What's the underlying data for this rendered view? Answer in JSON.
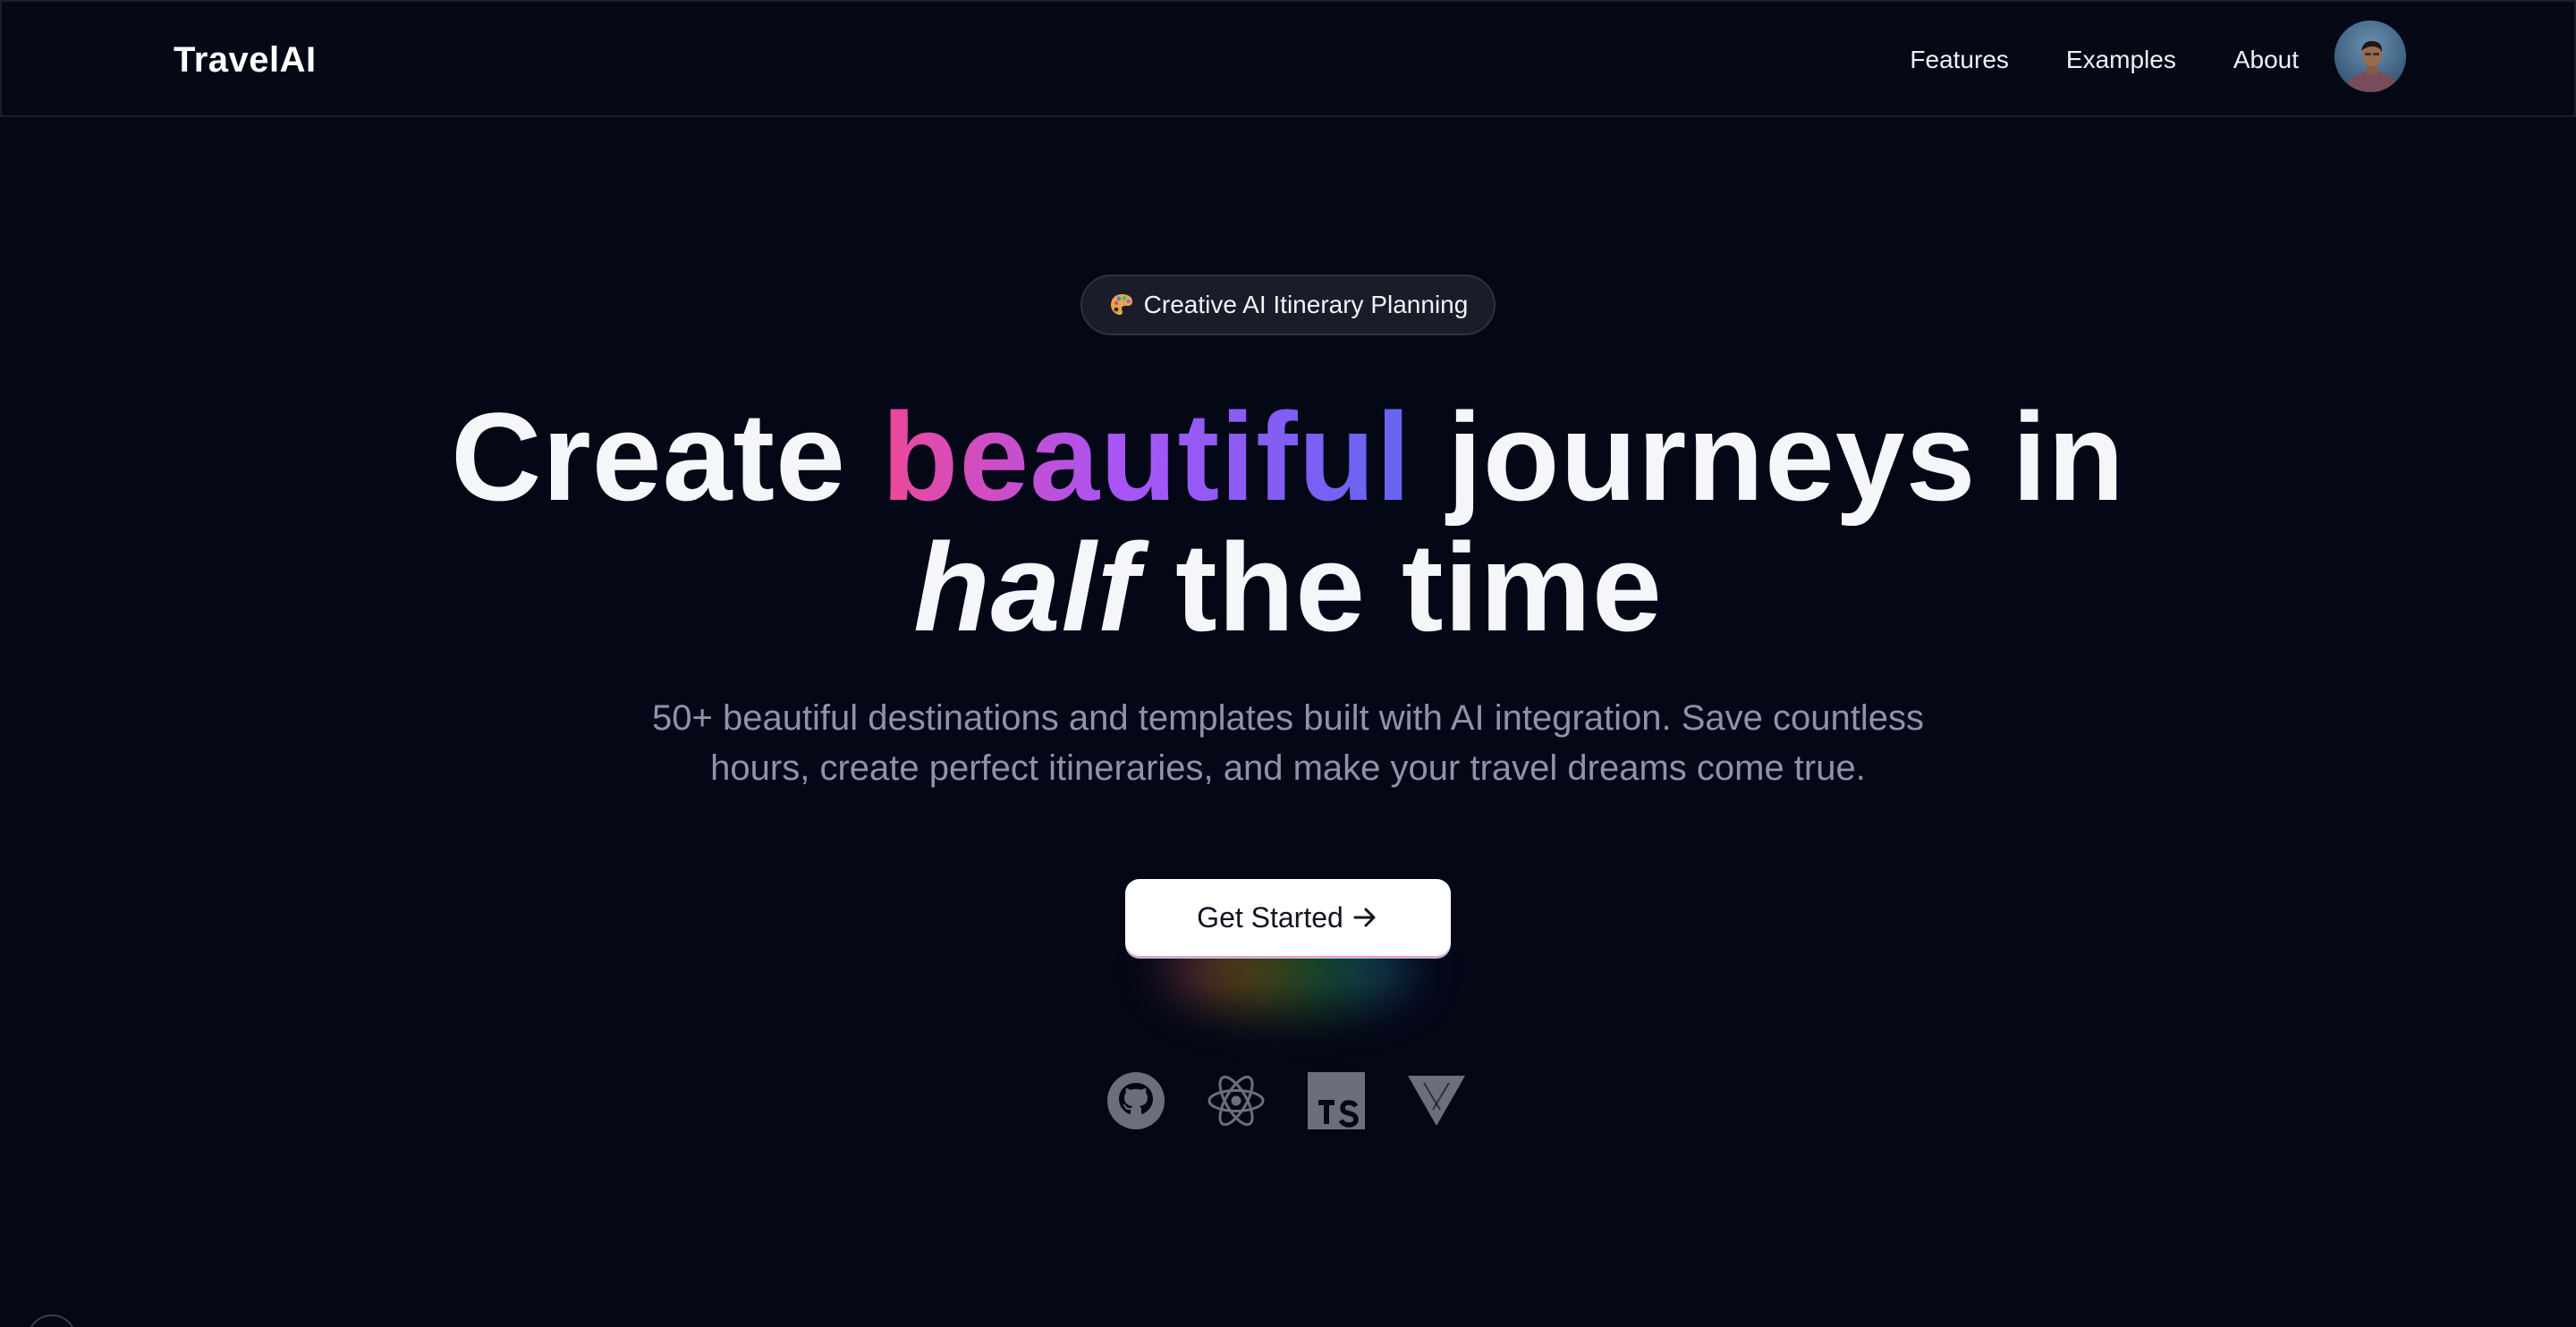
{
  "header": {
    "brand": "TravelAI",
    "nav": [
      {
        "label": "Features"
      },
      {
        "label": "Examples"
      },
      {
        "label": "About"
      }
    ],
    "avatar_icon": "user-avatar"
  },
  "hero": {
    "badge": {
      "icon": "palette-icon",
      "label": "Creative AI Itinerary Planning"
    },
    "headline": {
      "part1": "Create ",
      "highlight": "beautiful",
      "part2": " journeys in",
      "italic": "half",
      "part3": " the time"
    },
    "subtitle": "50+ beautiful destinations and templates built with AI integration. Save countless hours, create perfect itineraries, and make your travel dreams come true.",
    "cta": {
      "label": "Get Started",
      "icon": "arrow-right-icon"
    },
    "tech_icons": [
      "github-icon",
      "react-icon",
      "typescript-icon",
      "vercel-icon"
    ]
  },
  "colors": {
    "background": "#040716",
    "gradient_start": "#ec4899",
    "gradient_mid": "#a855f7",
    "gradient_end": "#6366f1",
    "subtitle": "#8d93a9",
    "icon_gray": "#6b6f7d"
  }
}
